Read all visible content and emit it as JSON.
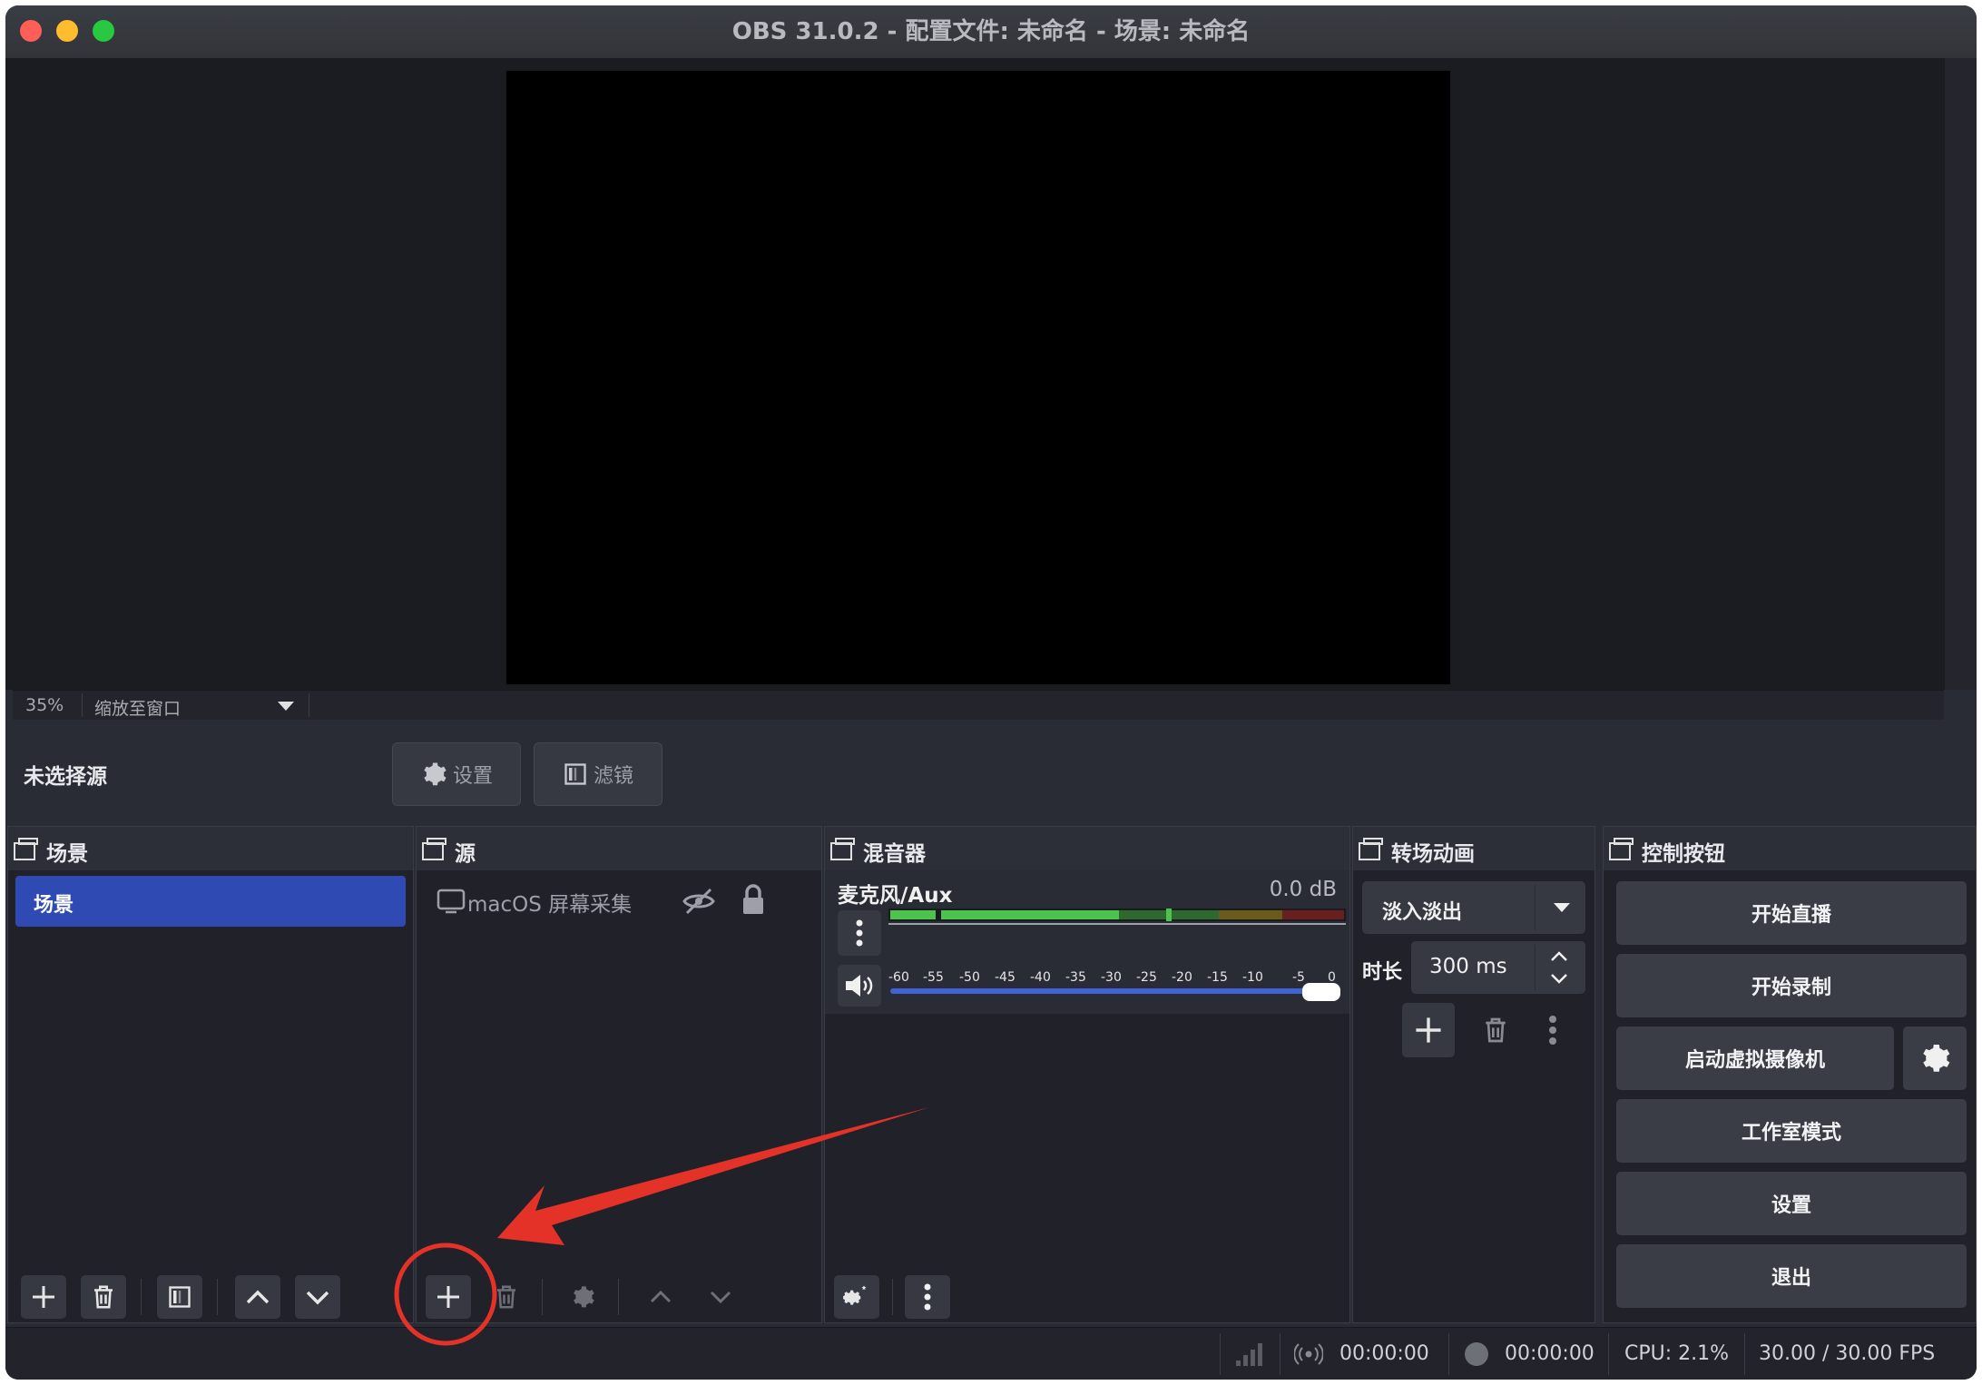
{
  "window": {
    "title": "OBS 31.0.2 - 配置文件: 未命名 - 场景: 未命名"
  },
  "preview": {
    "zoom_percent": "35%",
    "zoom_mode": "缩放至窗口"
  },
  "source_bar": {
    "no_source_label": "未选择源",
    "settings_label": "设置",
    "filters_label": "滤镜"
  },
  "scenes": {
    "title": "场景",
    "items": [
      {
        "label": "场景",
        "selected": true
      }
    ]
  },
  "sources": {
    "title": "源",
    "items": [
      {
        "label": "macOS 屏幕采集",
        "visible": false,
        "locked": true
      }
    ]
  },
  "mixer": {
    "title": "混音器",
    "channels": [
      {
        "name": "麦克风/Aux",
        "level": "0.0 dB",
        "volume_fraction": 1.0
      }
    ],
    "meter_ticks": [
      "-60",
      "-55",
      "-50",
      "-45",
      "-40",
      "-35",
      "-30",
      "-25",
      "-20",
      "-15",
      "-10",
      "-5",
      "0"
    ]
  },
  "transitions": {
    "title": "转场动画",
    "selected": "淡入淡出",
    "duration_label": "时长",
    "duration_value": "300 ms"
  },
  "controls": {
    "title": "控制按钮",
    "start_stream": "开始直播",
    "start_record": "开始录制",
    "start_virtual_cam": "启动虚拟摄像机",
    "studio_mode": "工作室模式",
    "settings": "设置",
    "exit": "退出"
  },
  "status": {
    "stream_time": "00:00:00",
    "record_time": "00:00:00",
    "cpu": "CPU: 2.1%",
    "fps": "30.00 / 30.00 FPS"
  },
  "colors": {
    "accent": "#2f4bb3",
    "annotation": "#e53228",
    "meter_green": "#4cc54c",
    "meter_yellow": "#b9a63a",
    "meter_red": "#c03232"
  }
}
